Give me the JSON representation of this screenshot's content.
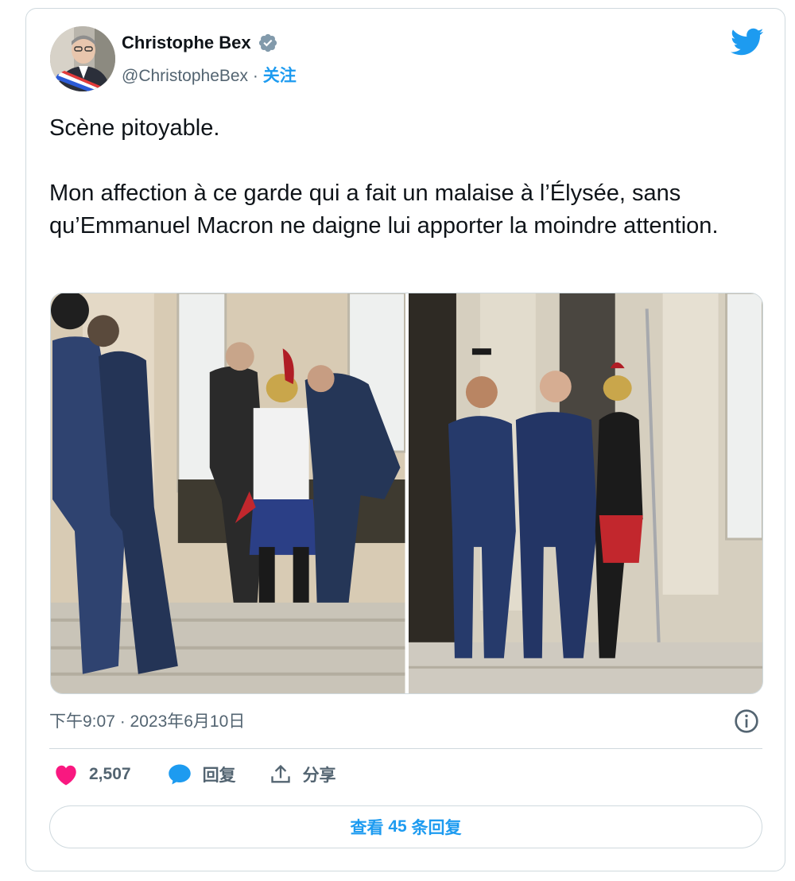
{
  "author": {
    "name": "Christophe Bex",
    "handle": "@ChristopheBex",
    "separator": " · ",
    "follow_label": "关注",
    "verified": true
  },
  "tweet": {
    "text": "Scène pitoyable.\n\nMon affection à ce garde qui a fait un malaise à l’Élysée, sans qu’Emmanuel Macron ne daigne lui apporter la moindre attention.",
    "timestamp": "下午9:07 · 2023年6月10日"
  },
  "actions": {
    "likes_count": "2,507",
    "reply_label": "回复",
    "share_label": "分享"
  },
  "replies_button": {
    "prefix": "查看 ",
    "count": "45",
    "suffix": " 条回复"
  },
  "colors": {
    "accent": "#1d9bf0",
    "like": "#f91880",
    "muted": "#536471",
    "border": "#cfd9de"
  },
  "icons": [
    "verified-badge-icon",
    "twitter-bird-icon",
    "info-icon",
    "heart-icon",
    "reply-bubble-icon",
    "share-icon"
  ]
}
